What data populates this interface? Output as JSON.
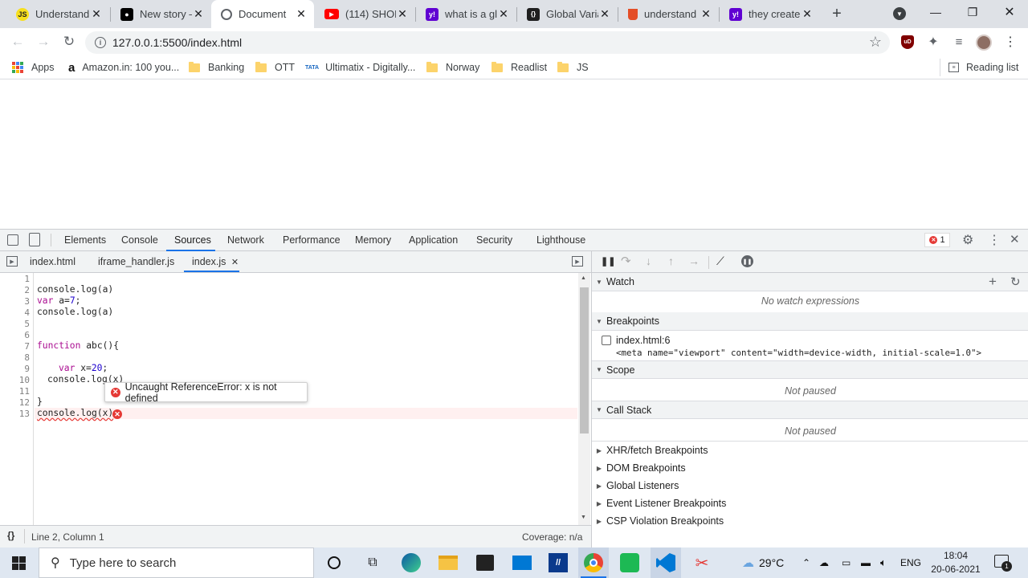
{
  "tabs": [
    {
      "title": "Understand",
      "icon": "js-icon",
      "fav_text": "JS",
      "fav_color": "#f7df1e"
    },
    {
      "title": "New story –",
      "icon": "medium-icon",
      "fav_text": "●",
      "fav_color": "#000000"
    },
    {
      "title": "Document",
      "icon": "globe-icon",
      "fav_text": "",
      "fav_color": "#ffffff"
    },
    {
      "title": "(114) SHOR",
      "icon": "youtube-icon",
      "fav_text": "▶",
      "fav_color": "#ff0000"
    },
    {
      "title": "what is a gl",
      "icon": "yahoo-icon",
      "fav_text": "y!",
      "fav_color": "#6001d2"
    },
    {
      "title": "Global Varia",
      "icon": "code-icon",
      "fav_text": "{}",
      "fav_color": "#1f1f1f"
    },
    {
      "title": "understand",
      "icon": "html5-icon",
      "fav_text": "",
      "fav_color": "#ffffff"
    },
    {
      "title": "they create",
      "icon": "yahoo-icon",
      "fav_text": "y!",
      "fav_color": "#6001d2"
    }
  ],
  "new_tab": "+",
  "address": {
    "url": "127.0.0.1:5500/index.html"
  },
  "bookmarks": [
    {
      "label": "Apps",
      "type": "apps"
    },
    {
      "label": "Amazon.in: 100 you...",
      "type": "amazon"
    },
    {
      "label": "Banking",
      "type": "folder"
    },
    {
      "label": "OTT",
      "type": "folder"
    },
    {
      "label": "Ultimatix - Digitally...",
      "type": "tata"
    },
    {
      "label": "Norway",
      "type": "folder"
    },
    {
      "label": "Readlist",
      "type": "folder"
    },
    {
      "label": "JS",
      "type": "folder"
    }
  ],
  "reading_list": "Reading list",
  "devtools": {
    "tabs": [
      "Elements",
      "Console",
      "Sources",
      "Network",
      "Performance",
      "Memory",
      "Application",
      "Security",
      "Lighthouse"
    ],
    "active_tab": "Sources",
    "error_count": "1",
    "files": [
      "index.html",
      "iframe_handler.js",
      "index.js"
    ],
    "active_file": "index.js",
    "line_numbers": [
      "1",
      "2",
      "3",
      "4",
      "5",
      "6",
      "7",
      "8",
      "9",
      "10",
      "11",
      "12",
      "13"
    ],
    "code": {
      "l2": "console.log(a)",
      "l3_kw": "var",
      "l3_rest": " a=",
      "l3_num": "7",
      "l3_end": ";",
      "l4": "console.log(a)",
      "l7_kw": "function",
      "l7_rest": " abc(){",
      "l9_kw": "var",
      "l9_rest": " x=",
      "l9_num": "20",
      "l9_end": ";",
      "l10": "console.log(x)",
      "l12": "}",
      "l13": "console.log(x)"
    },
    "error_tooltip": "Uncaught ReferenceError: x is not defined",
    "status": {
      "position": "Line 2, Column 1",
      "coverage": "Coverage: n/a"
    },
    "watch": {
      "title": "Watch",
      "empty": "No watch expressions"
    },
    "breakpoints": {
      "title": "Breakpoints",
      "file": "index.html:6",
      "snippet": "<meta name=\"viewport\" content=\"width=device-width, initial-scale=1.0\">"
    },
    "scope": {
      "title": "Scope",
      "empty": "Not paused"
    },
    "call_stack": {
      "title": "Call Stack",
      "empty": "Not paused"
    },
    "collapsed_sections": [
      "XHR/fetch Breakpoints",
      "DOM Breakpoints",
      "Global Listeners",
      "Event Listener Breakpoints",
      "CSP Violation Breakpoints"
    ]
  },
  "taskbar": {
    "search_placeholder": "Type here to search",
    "weather": "29°C",
    "language": "ENG",
    "time": "18:04",
    "date": "20-06-2021",
    "notifications": "1"
  }
}
